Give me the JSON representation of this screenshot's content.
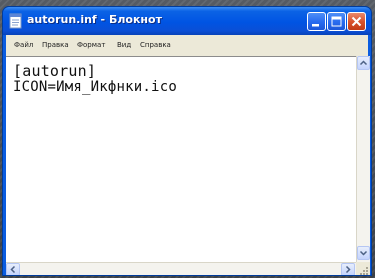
{
  "window": {
    "title": "autorun.inf - Блокнот"
  },
  "menu": {
    "items": [
      {
        "label": "Файл"
      },
      {
        "label": "Правка"
      },
      {
        "label": "Формат"
      },
      {
        "label": "Вид"
      },
      {
        "label": "Справка"
      }
    ]
  },
  "editor": {
    "lines": [
      "[autorun]",
      "ICON=Имя_Икфнки.ico"
    ]
  },
  "icons": {
    "app": "notepad-icon",
    "minimize": "minimize-icon",
    "maximize": "maximize-icon",
    "close": "close-icon"
  },
  "colors": {
    "titlebar": "#0054e3",
    "menubar": "#ece9d8",
    "close_button": "#d9532e",
    "editor_background": "#ffffff"
  }
}
